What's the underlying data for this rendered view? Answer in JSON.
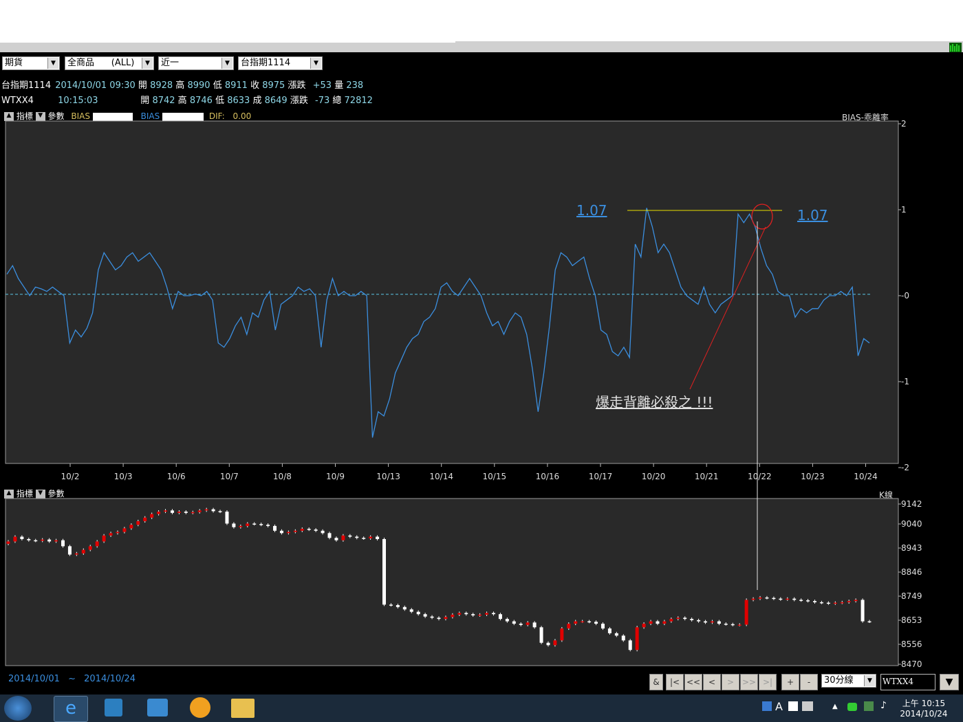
{
  "toolbar": {
    "selects": [
      "期貨",
      "全商品      (ALL)",
      "近一",
      "台指期1114"
    ]
  },
  "quotes": {
    "row1": {
      "name": "台指期1114",
      "datetime": "2014/10/01 09:30",
      "open_label": "開",
      "open": "8928",
      "high_label": "高",
      "high": "8990",
      "low_label": "低",
      "low": "8911",
      "close_label": "收",
      "close": "8975",
      "chg_label": "漲跌",
      "chg": "+53",
      "vol_label": "量",
      "vol": "238"
    },
    "row2": {
      "name": "WTXX4",
      "time": "10:15:03",
      "open_label": "開",
      "open": "8742",
      "high_label": "高",
      "high": "8746",
      "low_label": "低",
      "low": "8633",
      "close_label": "成",
      "close": "8649",
      "chg_label": "漲跌",
      "chg": "-73",
      "total_label": "總",
      "total": "72812"
    }
  },
  "panel1": {
    "indicator_label": "指標",
    "param_label": "參數",
    "bias_label_1": "BIAS",
    "bias_label_2": "BIAS",
    "dif_label": "DIF:",
    "dif_value": "0.00",
    "title": "BIAS-乖離率"
  },
  "panel2": {
    "indicator_label": "指標",
    "param_label": "參數",
    "title": "K線"
  },
  "annotations": {
    "left_value": "1.07",
    "right_value": "1.07",
    "note": "爆走背離必殺之 !!!"
  },
  "footer": {
    "date_from": "2014/10/01",
    "tilde": "~",
    "date_to": "2014/10/24",
    "buttons": [
      "&",
      "|<",
      "<<",
      "<",
      ">",
      ">>",
      ">|",
      "+",
      "-"
    ],
    "interval": "30分線",
    "symbol": "WTXX4"
  },
  "taskbar": {
    "time": "上午 10:15",
    "date": "2014/10/24"
  },
  "colors": {
    "bias_line": "#3b8fe0",
    "up_candle": "#e00000",
    "down_candle": "#ffffff",
    "accent_yellow": "#e8e000",
    "quote_cyan": "#8fd8e8"
  },
  "chart_data": [
    {
      "type": "line",
      "title": "BIAS-乖離率",
      "categories": [
        "10/2",
        "10/3",
        "10/6",
        "10/7",
        "10/8",
        "10/9",
        "10/13",
        "10/14",
        "10/15",
        "10/16",
        "10/17",
        "10/20",
        "10/21",
        "10/22",
        "10/23",
        "10/24"
      ],
      "ylim": [
        -2,
        2
      ],
      "yticks": [
        "2",
        "1",
        "-0",
        "-1",
        "-2"
      ],
      "series": [
        {
          "values": [
            0.25,
            0.35,
            0.2,
            0.1,
            0.0,
            0.1,
            0.08,
            0.05,
            0.1,
            0.05,
            0.0,
            -0.55,
            -0.4,
            -0.48,
            -0.38,
            -0.2,
            0.3,
            0.5,
            0.4,
            0.3,
            0.35,
            0.45,
            0.5,
            0.4,
            0.45,
            0.5,
            0.4,
            0.3,
            0.1,
            -0.15,
            0.05,
            0.0,
            0.0,
            0.02,
            0.0,
            0.05,
            -0.05,
            -0.55,
            -0.6,
            -0.5,
            -0.35,
            -0.25,
            -0.45,
            -0.2,
            -0.25,
            -0.05,
            0.05,
            -0.4,
            -0.1,
            -0.05,
            0.0,
            0.1,
            0.05,
            0.08,
            0.0,
            -0.6,
            -0.05,
            0.2,
            0.0,
            0.05,
            0.0,
            0.0,
            0.05,
            0.0,
            -1.65,
            -1.35,
            -1.4,
            -1.2,
            -0.9,
            -0.75,
            -0.6,
            -0.5,
            -0.45,
            -0.3,
            -0.25,
            -0.15,
            0.1,
            0.15,
            0.05,
            0.0,
            0.1,
            0.2,
            0.1,
            0.0,
            -0.2,
            -0.35,
            -0.3,
            -0.45,
            -0.3,
            -0.2,
            -0.25,
            -0.45,
            -0.85,
            -1.35,
            -0.9,
            -0.35,
            0.3,
            0.5,
            0.45,
            0.35,
            0.4,
            0.45,
            0.2,
            0.0,
            -0.4,
            -0.45,
            -0.65,
            -0.7,
            -0.6,
            -0.72,
            0.6,
            0.45,
            1.02,
            0.8,
            0.5,
            0.6,
            0.5,
            0.3,
            0.1,
            0.0,
            -0.05,
            -0.1,
            0.1,
            -0.1,
            -0.2,
            -0.1,
            -0.05,
            0.0,
            0.95,
            0.85,
            0.95,
            0.8,
            0.55,
            0.35,
            0.25,
            0.05,
            0.0,
            0.0,
            -0.25,
            -0.15,
            -0.2,
            -0.15,
            -0.15,
            -0.05,
            0.0,
            0.0,
            0.05,
            0.0,
            0.1,
            -0.7,
            -0.5,
            -0.55
          ]
        }
      ]
    },
    {
      "type": "candlestick",
      "title": "K線",
      "yticks": [
        "9142",
        "9040",
        "8943",
        "8846",
        "8749",
        "8653",
        "8556",
        "8470"
      ],
      "ylim": [
        8470,
        9142
      ],
      "close_values": [
        8985,
        9005,
        8995,
        8990,
        8988,
        8993,
        8985,
        8990,
        8965,
        8930,
        8935,
        8950,
        8965,
        8985,
        9010,
        9020,
        9025,
        9040,
        9055,
        9070,
        9085,
        9100,
        9110,
        9115,
        9105,
        9110,
        9105,
        9108,
        9115,
        9120,
        9112,
        9110,
        9060,
        9045,
        9050,
        9060,
        9058,
        9055,
        9050,
        9030,
        9020,
        9025,
        9030,
        9038,
        9035,
        9030,
        9020,
        9000,
        8990,
        9010,
        9005,
        9000,
        8998,
        9005,
        8995,
        8720,
        8718,
        8710,
        8700,
        8690,
        8680,
        8670,
        8665,
        8660,
        8668,
        8678,
        8685,
        8680,
        8675,
        8678,
        8685,
        8680,
        8660,
        8650,
        8640,
        8635,
        8645,
        8625,
        8560,
        8550,
        8570,
        8620,
        8640,
        8650,
        8650,
        8648,
        8640,
        8620,
        8600,
        8590,
        8570,
        8530,
        8625,
        8640,
        8650,
        8640,
        8650,
        8660,
        8665,
        8660,
        8655,
        8650,
        8645,
        8650,
        8640,
        8638,
        8635,
        8636,
        8740,
        8745,
        8750,
        8748,
        8745,
        8742,
        8745,
        8740,
        8738,
        8735,
        8730,
        8728,
        8725,
        8728,
        8730,
        8735,
        8740,
        8650,
        8649
      ]
    }
  ]
}
